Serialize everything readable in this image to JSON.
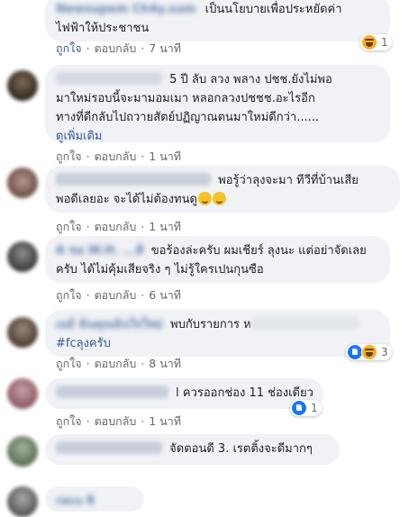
{
  "actions": {
    "like": "ถูกใจ",
    "reply": "ตอบกลับ",
    "sep": "·"
  },
  "comments": [
    {
      "name": "Newsupem Ch4y.sum",
      "lines": [
        "เป็นนโยบายเพื่อประหยัดค่า",
        "ไฟฟ้าให้ประชาชน"
      ],
      "time": "7 นาที",
      "reaction_count": "1"
    },
    {
      "name": "",
      "lines": [
        "5 ปี ลับ ลวง พลาง ปชช.ยังไม่พอ",
        "มาใหม่รอบนี้จะมามอมเมา หลอกลวงปชชช.อะไรอีก",
        "ทางที่ดีกลับไปถวายสัตย์ปฏิญาณตนมาใหม่ดีกว่า......"
      ],
      "see_more": "ดูเพิ่มเติม",
      "time": "1 นาที"
    },
    {
      "name": "",
      "lines": [
        "พอรู้ว่าลุงจะมา ทีวีที่บ้านเสีย",
        "พอดีเลยอะ จะได้ไม่ต้องทนดู"
      ],
      "time": "1 นาที"
    },
    {
      "name": "A ขอ W.H. ...ติ",
      "lines": [
        "ขอร้องล่ะครับ ผมเชียร์ ลุงนะ แต่อย่าจัดเลย",
        "ครับ ได้ไม่คุ้มเสียจริง ๆ ไม่รู้ใครเปนกุนซือ"
      ],
      "time": "6 นาที"
    },
    {
      "name": "เมย์ ฉันคุณฉันใจใหม่",
      "lines": [
        "พบกับรายการ ห",
        "#fcลุงครับ"
      ],
      "time": "8 นาที",
      "reaction_count": "3"
    },
    {
      "name": "",
      "lines": [
        "l ควรออกช่อง 11 ช่องเดียว"
      ],
      "time": "1 นาที",
      "reaction_count": "1"
    },
    {
      "name": "",
      "lines": [
        "จัดตอนดี 3. เรตติ้งจะดีมากๆ"
      ]
    },
    {
      "name": "กดเน พิ"
    }
  ]
}
